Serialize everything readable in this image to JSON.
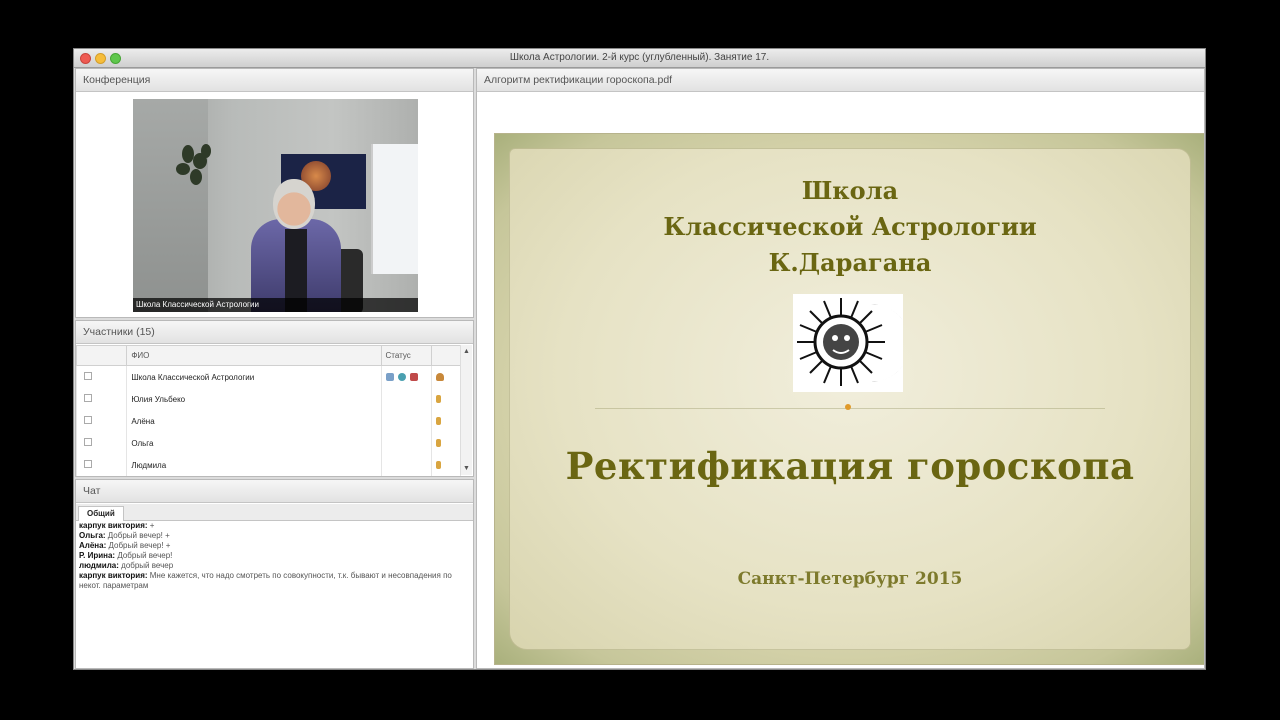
{
  "window": {
    "title": "Школа Астрологии. 2-й курс (углубленный). Занятие 17."
  },
  "conference": {
    "header": "Конференция",
    "video_caption": "Школа Классической Астрологии"
  },
  "participants": {
    "header": "Участники (15)",
    "columns": [
      "ФИО",
      "Статус"
    ],
    "rows": [
      {
        "name": "Школа Классической Астрологии"
      },
      {
        "name": "Юлия Ульбеко"
      },
      {
        "name": "Алёна"
      },
      {
        "name": "Ольга"
      },
      {
        "name": "Людмила"
      }
    ]
  },
  "chat": {
    "header": "Чат",
    "tab": "Общий",
    "messages": [
      {
        "author": "карпук виктория:",
        "text": "+"
      },
      {
        "author": "Ольга:",
        "text": "Добрый вечер! +"
      },
      {
        "author": "Алёна:",
        "text": "Добрый вечер! +"
      },
      {
        "author": "Р. Ирина:",
        "text": "Добрый вечер!"
      },
      {
        "author": "людмила:",
        "text": "добрый вечер"
      },
      {
        "author": "карпук виктория:",
        "text": "Мне кажется, что надо смотреть по совокупности, т.к. бывают и несовпадения по некот. параметрам"
      }
    ]
  },
  "pdf": {
    "header": "Алгоритм ректификации гороскопа.pdf",
    "slide": {
      "line1": "Школа",
      "line2": "Классической Астрологии",
      "line3": "К.Дарагана",
      "title": "Ректификация гороскопа",
      "city": "Санкт-Петербург 2015"
    }
  },
  "colors": {
    "slide_text": "#6a6612",
    "accent_dot": "#e09a2a"
  }
}
